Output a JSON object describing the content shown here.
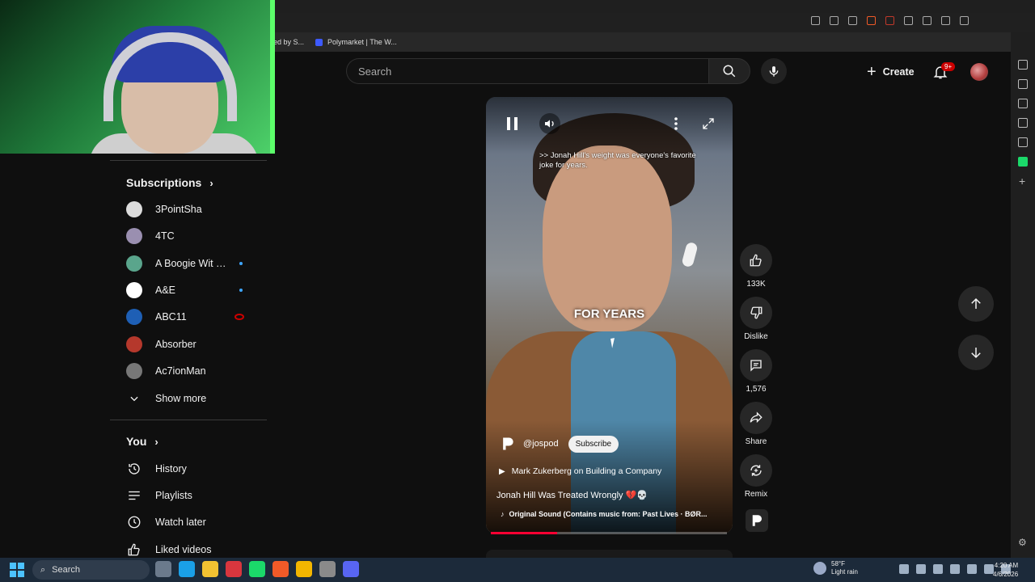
{
  "browser": {
    "bookmarks": [
      {
        "label": "ed by S..."
      },
      {
        "label": "Polymarket | The W..."
      }
    ]
  },
  "header": {
    "search_placeholder": "Search",
    "create_label": "Create",
    "notification_count": "9+"
  },
  "sidebar": {
    "subscriptions_title": "Subscriptions",
    "subscriptions": [
      {
        "label": "3PointSha",
        "color": "#dcdcdc",
        "indicator": "none"
      },
      {
        "label": "4TC",
        "color": "#9a8fb0",
        "indicator": "none"
      },
      {
        "label": "A Boogie Wit da ...",
        "color": "#5aa58c",
        "indicator": "new"
      },
      {
        "label": "A&E",
        "color": "#ffffff",
        "indicator": "new"
      },
      {
        "label": "ABC11",
        "color": "#1e5fb5",
        "indicator": "live"
      },
      {
        "label": "Absorber",
        "color": "#b5382c",
        "indicator": "none"
      },
      {
        "label": "Ac7ionMan",
        "color": "#777777",
        "indicator": "none"
      }
    ],
    "show_more": "Show more",
    "you_title": "You",
    "you_items": [
      {
        "label": "History",
        "icon": "history-icon"
      },
      {
        "label": "Playlists",
        "icon": "playlists-icon"
      },
      {
        "label": "Watch later",
        "icon": "clock-icon"
      },
      {
        "label": "Liked videos",
        "icon": "thumb-up-icon"
      }
    ]
  },
  "short": {
    "caption": ">> Jonah Hill's weight was everyone's favorite joke for years.",
    "overlay_text": "FOR YEARS",
    "channel": "@jospod",
    "subscribe_label": "Subscribe",
    "related_video": "Mark Zukerberg on Building a Company",
    "title": "Jonah Hill Was Treated Wrongly 💔💀",
    "sound": "Original Sound (Contains music from: Past Lives · BØR...",
    "progress_fraction": 0.28
  },
  "actions": {
    "like_count": "133K",
    "dislike_label": "Dislike",
    "comment_count": "1,576",
    "share_label": "Share",
    "remix_label": "Remix"
  },
  "taskbar": {
    "search_label": "Search",
    "weather_temp": "58°F",
    "weather_desc": "Light rain",
    "time": "4:20 AM",
    "date": "4/6/2026"
  },
  "colors": {
    "accent_red": "#ff0033",
    "link_blue": "#3ea6ff",
    "background": "#0f0f0f"
  }
}
